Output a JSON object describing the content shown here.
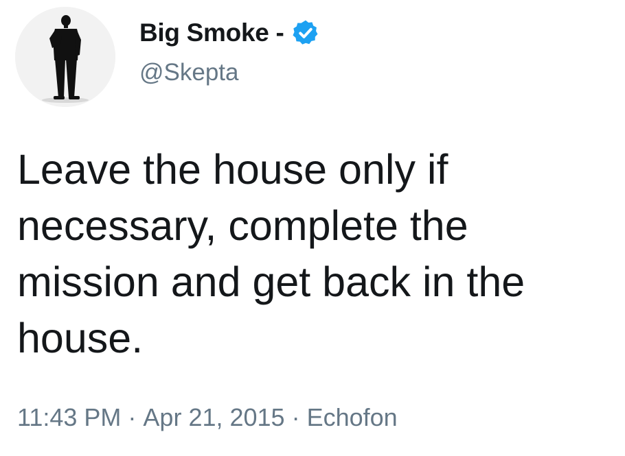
{
  "user": {
    "display_name": "Big Smoke -",
    "handle": "@Skepta",
    "verified_icon": "verified-badge-icon",
    "avatar_icon": "avatar-silhouette"
  },
  "tweet": {
    "text": "Leave the house only if necessary, complete the mission and get back in the house.",
    "time": "11:43 PM",
    "date": "Apr 21, 2015",
    "source": "Echofon",
    "separator": "·"
  },
  "colors": {
    "text_primary": "#14171a",
    "text_secondary": "#657786",
    "verified_blue": "#1da1f2",
    "background": "#ffffff"
  }
}
